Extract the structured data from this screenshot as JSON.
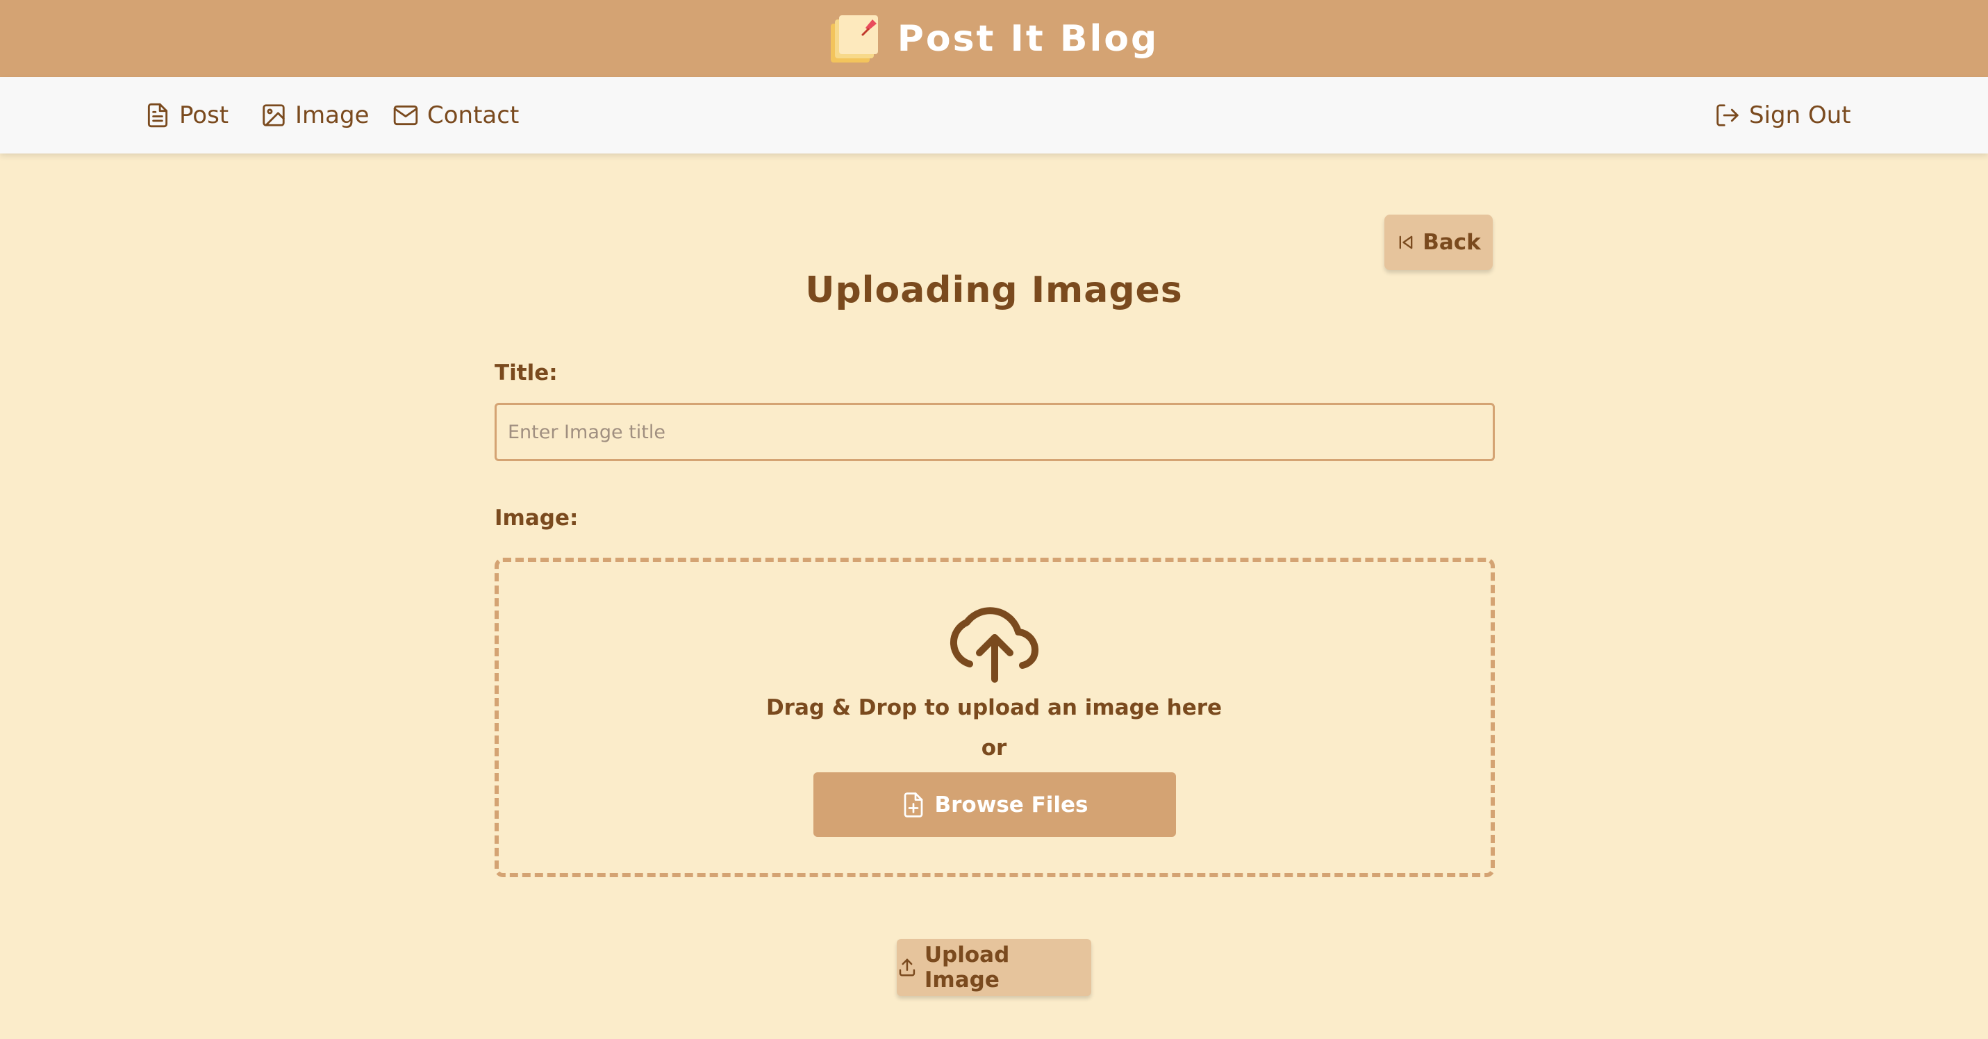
{
  "header": {
    "title": "Post It Blog",
    "logo_icon": "sticky-notes-icon",
    "background_color": "#d4a373"
  },
  "nav": {
    "items": [
      {
        "label": "Post",
        "icon": "document-icon"
      },
      {
        "label": "Image",
        "icon": "image-icon"
      },
      {
        "label": "Contact",
        "icon": "mail-icon"
      }
    ],
    "sign_out": {
      "label": "Sign Out",
      "icon": "sign-out-icon"
    }
  },
  "main": {
    "back_button": {
      "label": "Back",
      "icon": "skip-back-icon"
    },
    "title": "Uploading Images",
    "title_field": {
      "label": "Title:",
      "placeholder": "Enter Image title",
      "value": ""
    },
    "image_field": {
      "label": "Image:",
      "dropzone": {
        "icon": "cloud-upload-icon",
        "text": "Drag & Drop to upload an image here",
        "or": "or",
        "browse_label": "Browse Files",
        "browse_icon": "file-plus-icon"
      }
    },
    "upload_button": {
      "label": "Upload Image",
      "icon": "upload-icon"
    }
  },
  "colors": {
    "page_background": "#fbecca",
    "accent": "#d4a373",
    "text": "#7a4a1e",
    "button_light": "#e6c49c"
  }
}
